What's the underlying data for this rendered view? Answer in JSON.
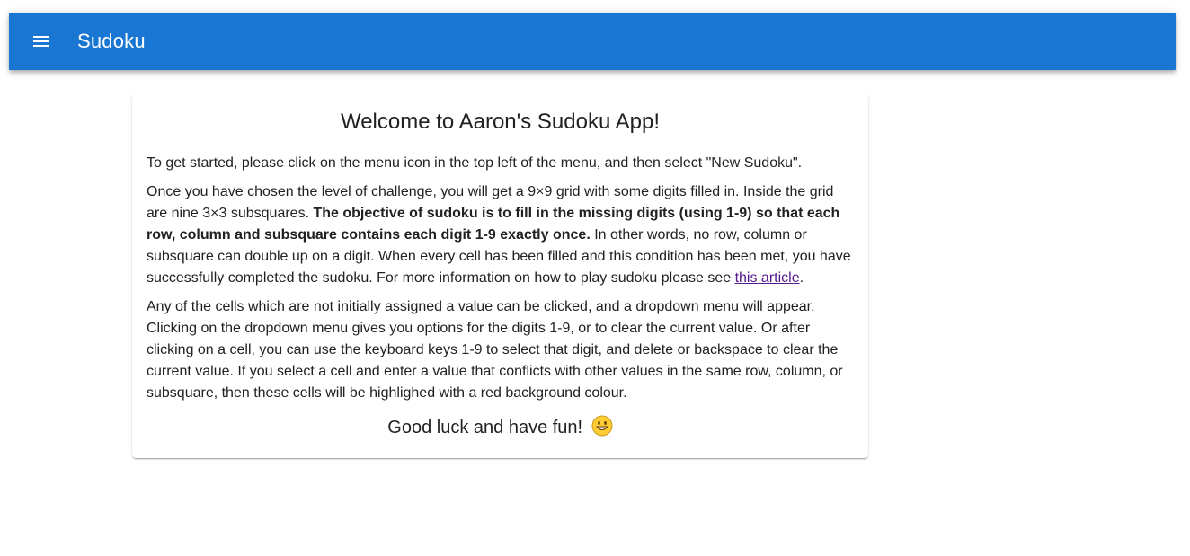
{
  "appbar": {
    "title": "Sudoku",
    "menu_icon": "hamburger-menu-icon",
    "color": "#1976d2"
  },
  "welcome": {
    "heading": "Welcome to Aaron's Sudoku App!",
    "p1": "To get started, please click on the menu icon in the top left of the menu, and then select \"New Sudoku\".",
    "p2_start": "Once you have chosen the level of challenge, you will get a 9×9 grid with some digits filled in. Inside the grid are nine 3×3 subsquares. ",
    "p2_bold": "The objective of sudoku is to fill in the missing digits (using 1-9) so that each row, column and subsquare contains each digit 1-9 exactly once.",
    "p2_end": " In other words, no row, column or subsquare can double up on a digit. When every cell has been filled and this condition has been met, you have successfully completed the sudoku. For more information on how to play sudoku please see ",
    "p2_link": "this article",
    "p2_after_link": ".",
    "p3": "Any of the cells which are not initially assigned a value can be clicked, and a dropdown menu will appear. Clicking on the dropdown menu gives you options for the digits 1-9, or to clear the current value. Or after clicking on a cell, you can use the keyboard keys 1-9 to select that digit, and delete or backspace to clear the current value. If you select a cell and enter a value that conflicts with other values in the same row, column, or subsquare, then these cells will be highlighed with a red background colour.",
    "closing": "Good luck and have fun!",
    "closing_icon": "grinning-face-icon",
    "link_color": "#551a8b"
  }
}
